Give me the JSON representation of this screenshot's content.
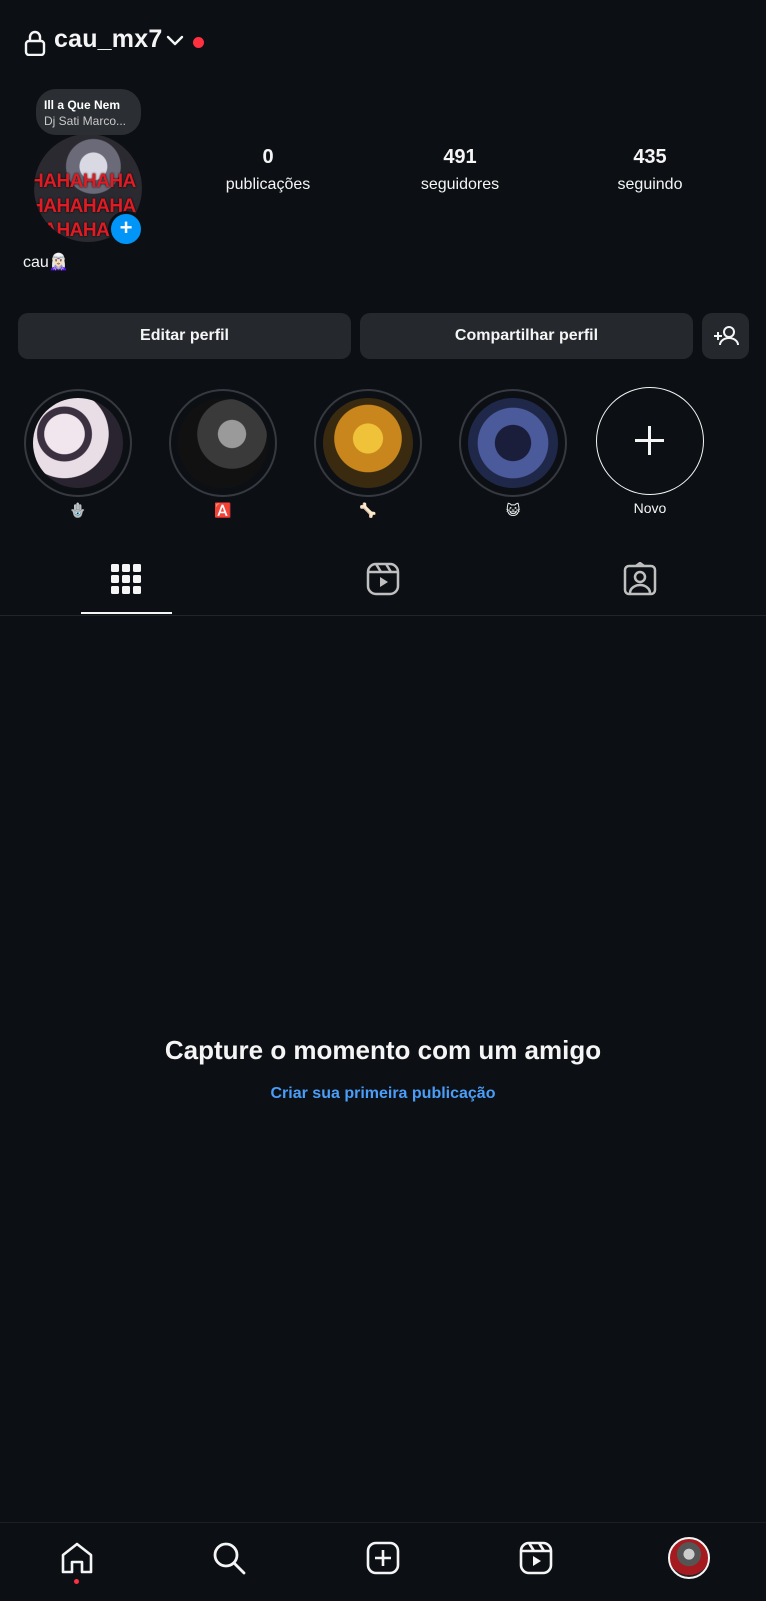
{
  "header": {
    "username": "cau_mx7"
  },
  "profile": {
    "music_title": "Ill a Que Nem",
    "music_artist": "Dj Sati Marco...",
    "avatar_text": "HAHAHAHA",
    "display_name": "cau🧝🏻‍♀️",
    "stats": [
      {
        "value": "0",
        "label": "publicações"
      },
      {
        "value": "491",
        "label": "seguidores"
      },
      {
        "value": "435",
        "label": "seguindo"
      }
    ]
  },
  "actions": {
    "edit": "Editar perfil",
    "share": "Compartilhar perfil",
    "add_badge": "+",
    "add_person": "+"
  },
  "highlights": [
    {
      "label": "🪬"
    },
    {
      "label": "🅰️"
    },
    {
      "label": "🦴"
    },
    {
      "label": "😺"
    },
    {
      "label": "Novo"
    }
  ],
  "empty_state": {
    "title": "Capture o momento com um amigo",
    "link": "Criar sua primeira publicação"
  },
  "colors": {
    "background": "#0c1014",
    "accent": "#0095f6",
    "link": "#4a9df8",
    "notification": "#ff3040"
  },
  "icons": [
    "lock-icon",
    "chevron-down-icon",
    "grid-icon",
    "reels-icon",
    "tagged-icon",
    "home-icon",
    "search-icon",
    "create-icon",
    "reels-nav-icon"
  ]
}
